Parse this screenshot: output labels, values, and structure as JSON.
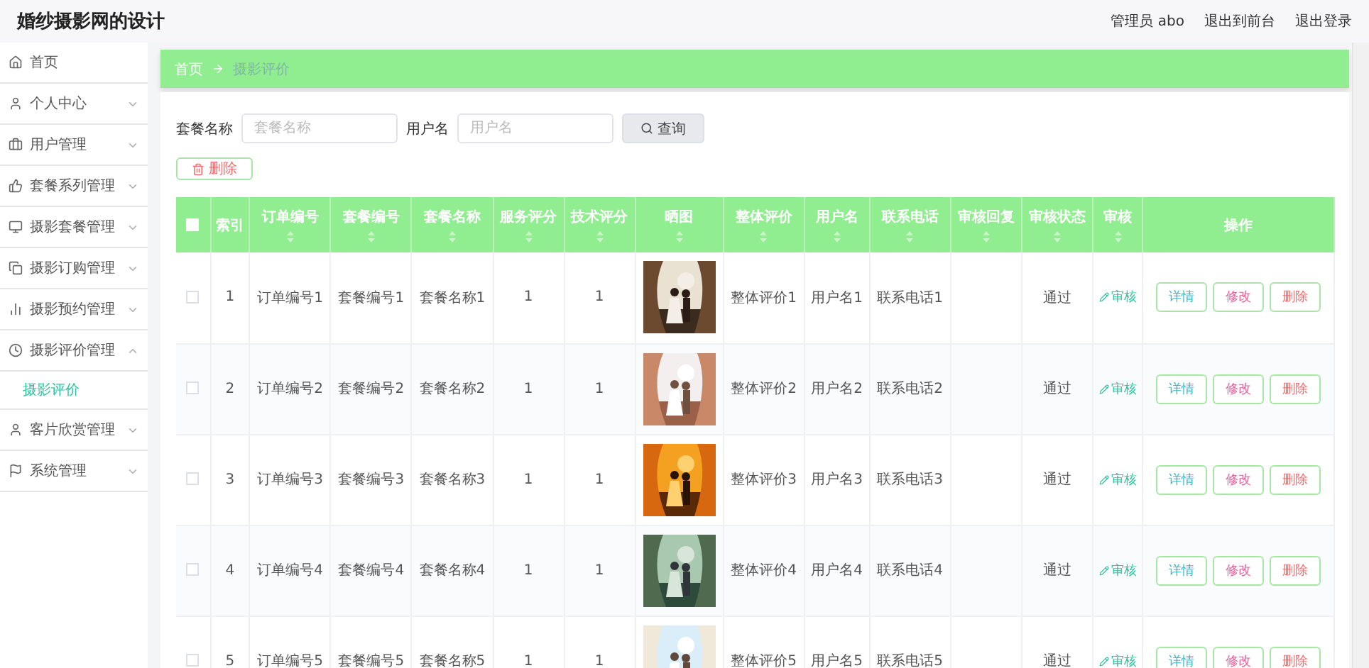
{
  "header": {
    "title": "婚纱摄影网的设计",
    "links": [
      "管理员 abo",
      "退出到前台",
      "退出登录"
    ]
  },
  "sidebar": {
    "items": [
      {
        "label": "首页",
        "kind": "link"
      },
      {
        "label": "个人中心",
        "kind": "menu",
        "expanded": false
      },
      {
        "label": "用户管理",
        "kind": "menu",
        "expanded": false
      },
      {
        "label": "套餐系列管理",
        "kind": "menu",
        "expanded": false
      },
      {
        "label": "摄影套餐管理",
        "kind": "menu",
        "expanded": false
      },
      {
        "label": "摄影订购管理",
        "kind": "menu",
        "expanded": false
      },
      {
        "label": "摄影预约管理",
        "kind": "menu",
        "expanded": false
      },
      {
        "label": "摄影评价管理",
        "kind": "menu",
        "expanded": true,
        "children": [
          {
            "label": "摄影评价",
            "selected": true
          }
        ]
      },
      {
        "label": "客片欣赏管理",
        "kind": "menu",
        "expanded": false
      },
      {
        "label": "系统管理",
        "kind": "menu",
        "expanded": false
      }
    ]
  },
  "breadcrumb": [
    "首页",
    "摄影评价"
  ],
  "search": {
    "fields": [
      {
        "label": "套餐名称",
        "placeholder": "套餐名称"
      },
      {
        "label": "用户名",
        "placeholder": "用户名"
      }
    ],
    "button": "查询"
  },
  "delete_button": "删除",
  "table": {
    "select_all": false,
    "columns": [
      {
        "label": "索引",
        "sortable": false
      },
      {
        "label": "订单编号",
        "sortable": true
      },
      {
        "label": "套餐编号",
        "sortable": true
      },
      {
        "label": "套餐名称",
        "sortable": true
      },
      {
        "label": "服务评分",
        "sortable": true
      },
      {
        "label": "技术评分",
        "sortable": true
      },
      {
        "label": "晒图",
        "sortable": true
      },
      {
        "label": "整体评价",
        "sortable": true
      },
      {
        "label": "用户名",
        "sortable": true
      },
      {
        "label": "联系电话",
        "sortable": true
      },
      {
        "label": "审核回复",
        "sortable": true
      },
      {
        "label": "审核状态",
        "sortable": true
      },
      {
        "label": "审核",
        "sortable": true
      },
      {
        "label": "操作",
        "sortable": false
      }
    ],
    "rows": [
      {
        "selected": false,
        "cells": [
          "1",
          "订单编号1",
          "套餐编号1",
          "套餐名称1",
          "1",
          "1"
        ],
        "cells2": [
          "整体评价1",
          "用户名1",
          "联系电话1"
        ],
        "status": "通过",
        "review": "审核",
        "actions": [
          "详情",
          "修改",
          "删除"
        ]
      },
      {
        "selected": false,
        "cells": [
          "2",
          "订单编号2",
          "套餐编号2",
          "套餐名称2",
          "1",
          "1"
        ],
        "cells2": [
          "整体评价2",
          "用户名2",
          "联系电话2"
        ],
        "status": "通过",
        "review": "审核",
        "actions": [
          "详情",
          "修改",
          "删除"
        ]
      },
      {
        "selected": false,
        "cells": [
          "3",
          "订单编号3",
          "套餐编号3",
          "套餐名称3",
          "1",
          "1"
        ],
        "cells2": [
          "整体评价3",
          "用户名3",
          "联系电话3"
        ],
        "status": "通过",
        "review": "审核",
        "actions": [
          "详情",
          "修改",
          "删除"
        ]
      },
      {
        "selected": false,
        "cells": [
          "4",
          "订单编号4",
          "套餐编号4",
          "套餐名称4",
          "1",
          "1"
        ],
        "cells2": [
          "整体评价4",
          "用户名4",
          "联系电话4"
        ],
        "status": "通过",
        "review": "审核",
        "actions": [
          "详情",
          "修改",
          "删除"
        ]
      },
      {
        "selected": false,
        "cells": [
          "5",
          "订单编号5",
          "套餐编号5",
          "套餐名称5",
          "1",
          "1"
        ],
        "cells2": [
          "整体评价5",
          "用户名5",
          "联系电话5"
        ],
        "status": "通过",
        "review": "审核",
        "actions": [
          "详情",
          "修改",
          "删除"
        ]
      }
    ]
  }
}
